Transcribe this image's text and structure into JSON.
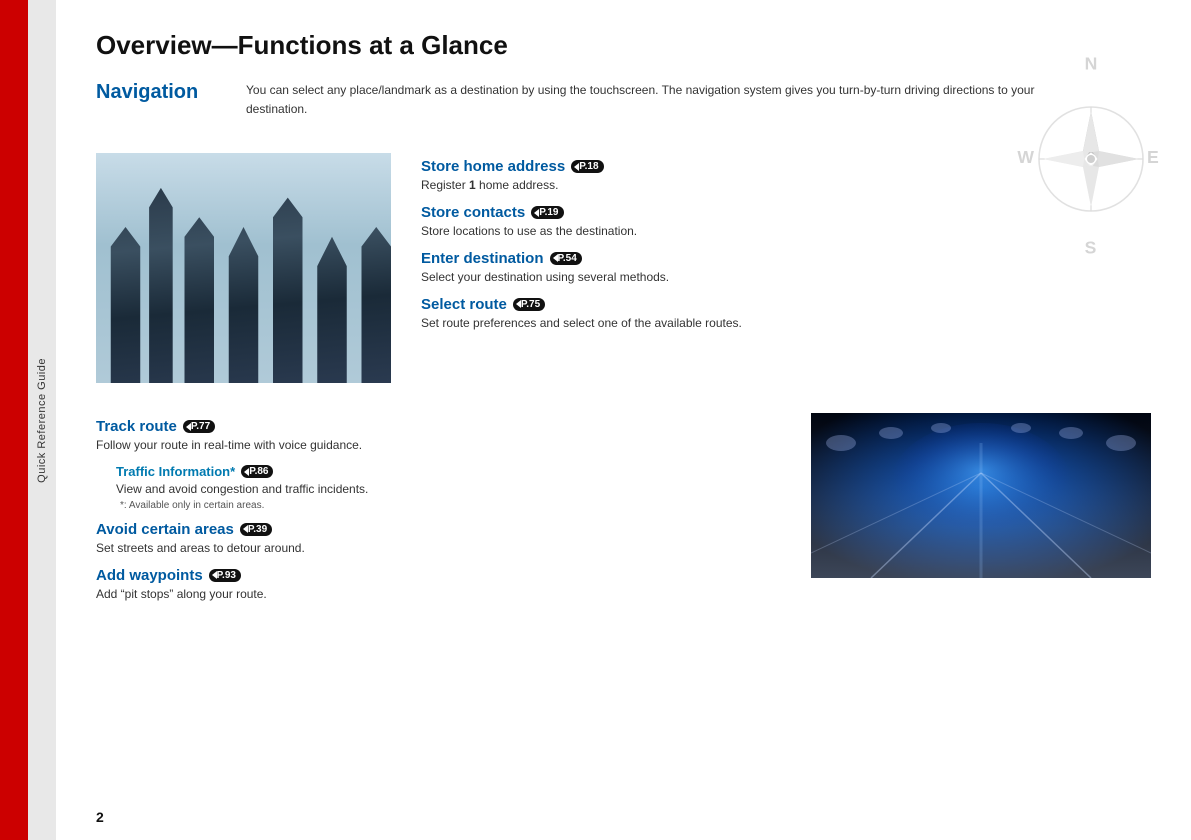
{
  "sidebar": {
    "rotated_text": "Quick Reference Guide"
  },
  "page": {
    "title": "Overview—Functions at a Glance",
    "number": "2"
  },
  "navigation": {
    "label": "Navigation",
    "description": "You can select any place/landmark as a destination by using the touchscreen. The navigation system gives you turn-by-turn driving directions to your destination.",
    "features": [
      {
        "title": "Store home address",
        "badge": "P.18",
        "description": "Register 1 home address.",
        "description_bold": "1"
      },
      {
        "title": "Store contacts",
        "badge": "P.19",
        "description": "Store locations to use as the destination."
      },
      {
        "title": "Enter destination",
        "badge": "P.54",
        "description": "Select your destination using several methods."
      },
      {
        "title": "Select route",
        "badge": "P.75",
        "description": "Set route preferences and select one of the available routes."
      }
    ],
    "bottom_features": [
      {
        "title": "Track route",
        "badge": "P.77",
        "description": "Follow your route in real-time with voice guidance.",
        "sub": {
          "title": "Traffic Information*",
          "badge": "P.86",
          "description": "View and avoid congestion and traffic incidents.",
          "note": "*: Available only in certain areas."
        }
      },
      {
        "title": "Avoid certain areas",
        "badge": "P.39",
        "description": "Set streets and areas to detour around."
      },
      {
        "title": "Add waypoints",
        "badge": "P.93",
        "description": "Add “pit stops” along your route."
      }
    ]
  }
}
